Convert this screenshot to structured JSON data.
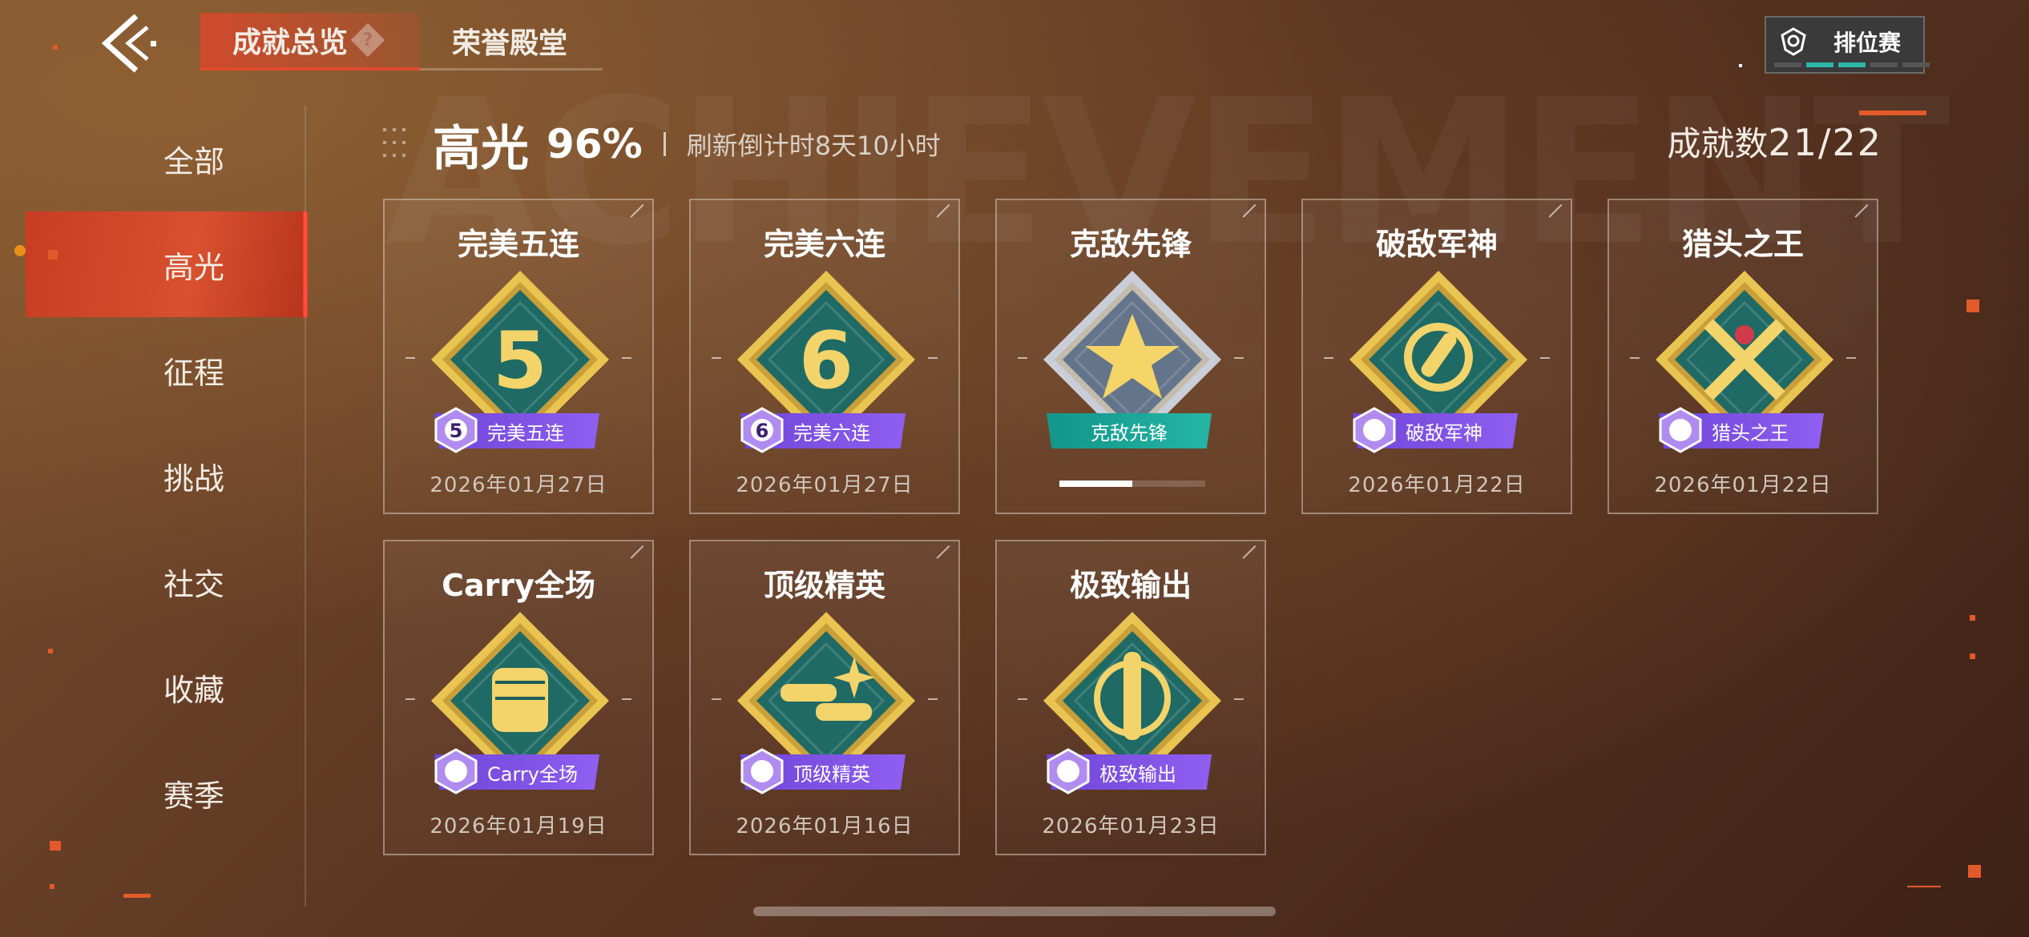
{
  "watermark": "ACHIEVEMENT",
  "topbar": {
    "tabs": [
      {
        "label": "成就总览",
        "help": "?"
      },
      {
        "label": "荣誉殿堂"
      }
    ],
    "mode_label": "排位赛"
  },
  "sidebar": {
    "items": [
      {
        "label": "全部"
      },
      {
        "label": "高光"
      },
      {
        "label": "征程"
      },
      {
        "label": "挑战"
      },
      {
        "label": "社交"
      },
      {
        "label": "收藏"
      },
      {
        "label": "赛季"
      }
    ],
    "active": "高光"
  },
  "header": {
    "title": "高光",
    "percent": "96%",
    "refresh": "刷新倒计时8天10小时",
    "count_label": "成就数",
    "count_value": "21/22"
  },
  "cards": [
    {
      "title": "完美五连",
      "banner": "完美五连",
      "date": "2026年01月27日",
      "medal": "5",
      "banner_color": "purple"
    },
    {
      "title": "完美六连",
      "banner": "完美六连",
      "date": "2026年01月27日",
      "medal": "6",
      "banner_color": "purple"
    },
    {
      "title": "克敌先锋",
      "banner": "克敌先锋",
      "date": "",
      "medal": "star",
      "banner_color": "teal",
      "progress": 0.5
    },
    {
      "title": "破敌军神",
      "banner": "破敌军神",
      "date": "2026年01月22日",
      "medal": "sun",
      "banner_color": "purple"
    },
    {
      "title": "猎头之王",
      "banner": "猎头之王",
      "date": "2026年01月22日",
      "medal": "crossed",
      "banner_color": "purple"
    },
    {
      "title": "Carry全场",
      "banner": "Carry全场",
      "date": "2026年01月19日",
      "medal": "fist",
      "banner_color": "purple"
    },
    {
      "title": "顶级精英",
      "banner": "顶级精英",
      "date": "2026年01月16日",
      "medal": "bullets",
      "banner_color": "purple"
    },
    {
      "title": "极致输出",
      "banner": "极致输出",
      "date": "2026年01月23日",
      "medal": "target",
      "banner_color": "purple"
    }
  ],
  "colors": {
    "accent": "#e04a2c",
    "gold": "#e8c04a",
    "teal_medal": "#1f6a64",
    "purple_banner": "#7a4fe2",
    "teal_banner": "#18a898"
  }
}
